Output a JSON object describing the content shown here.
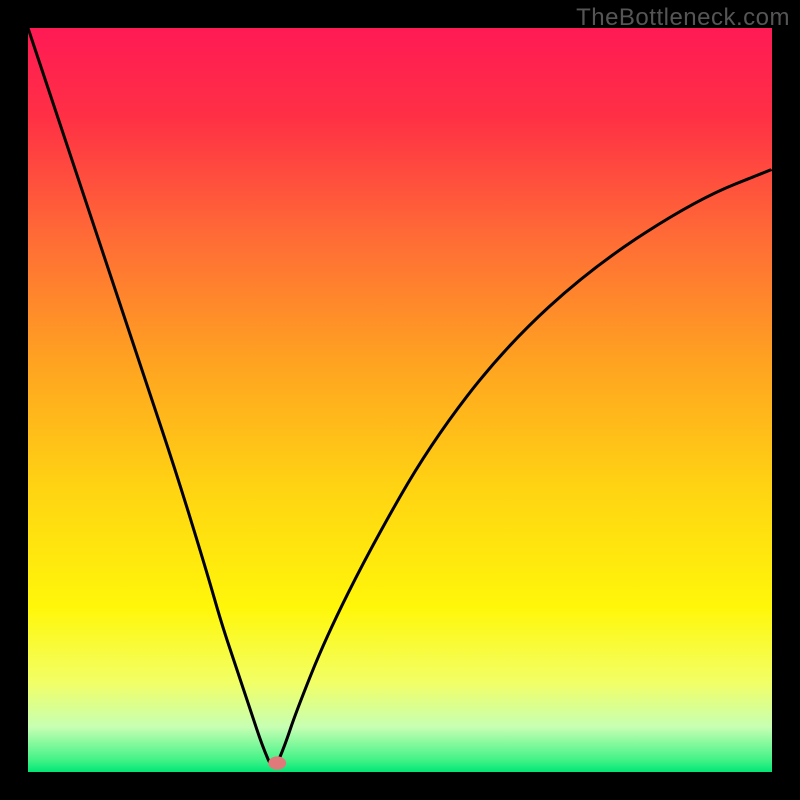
{
  "watermark": "TheBottleneck.com",
  "chart_data": {
    "type": "line",
    "title": "",
    "xlabel": "",
    "ylabel": "",
    "xlim": [
      0,
      100
    ],
    "ylim": [
      0,
      100
    ],
    "grid": false,
    "legend": false,
    "background": {
      "style": "vertical-gradient",
      "stops": [
        {
          "pos": 0.0,
          "color": "#ff1a55"
        },
        {
          "pos": 0.12,
          "color": "#ff3045"
        },
        {
          "pos": 0.28,
          "color": "#ff6b36"
        },
        {
          "pos": 0.45,
          "color": "#ffa321"
        },
        {
          "pos": 0.62,
          "color": "#ffd412"
        },
        {
          "pos": 0.78,
          "color": "#fff70a"
        },
        {
          "pos": 0.88,
          "color": "#f2ff66"
        },
        {
          "pos": 0.94,
          "color": "#c6ffb3"
        },
        {
          "pos": 0.985,
          "color": "#3ff286"
        },
        {
          "pos": 1.0,
          "color": "#00e676"
        }
      ]
    },
    "curve": {
      "description": "bottleneck V-curve with minimum near x≈33, left arm steeper, right arm concave-down",
      "x": [
        0,
        4,
        8,
        12,
        16,
        20,
        24,
        26,
        28,
        30,
        31.5,
        33,
        34.5,
        36,
        40,
        46,
        54,
        64,
        76,
        90,
        100
      ],
      "y": [
        100,
        88,
        76,
        64,
        52,
        40,
        27,
        20,
        14,
        8,
        3.5,
        0,
        3.5,
        8,
        18,
        30,
        44,
        57,
        68,
        77,
        81
      ]
    },
    "marker": {
      "x": 33.5,
      "y": 1.2,
      "shape": "ellipse",
      "color": "#e07a7a",
      "rx": 1.2,
      "ry": 0.9
    }
  },
  "colors": {
    "frame": "#000000",
    "curve_stroke": "#000000",
    "marker_fill": "#e07a7a"
  }
}
